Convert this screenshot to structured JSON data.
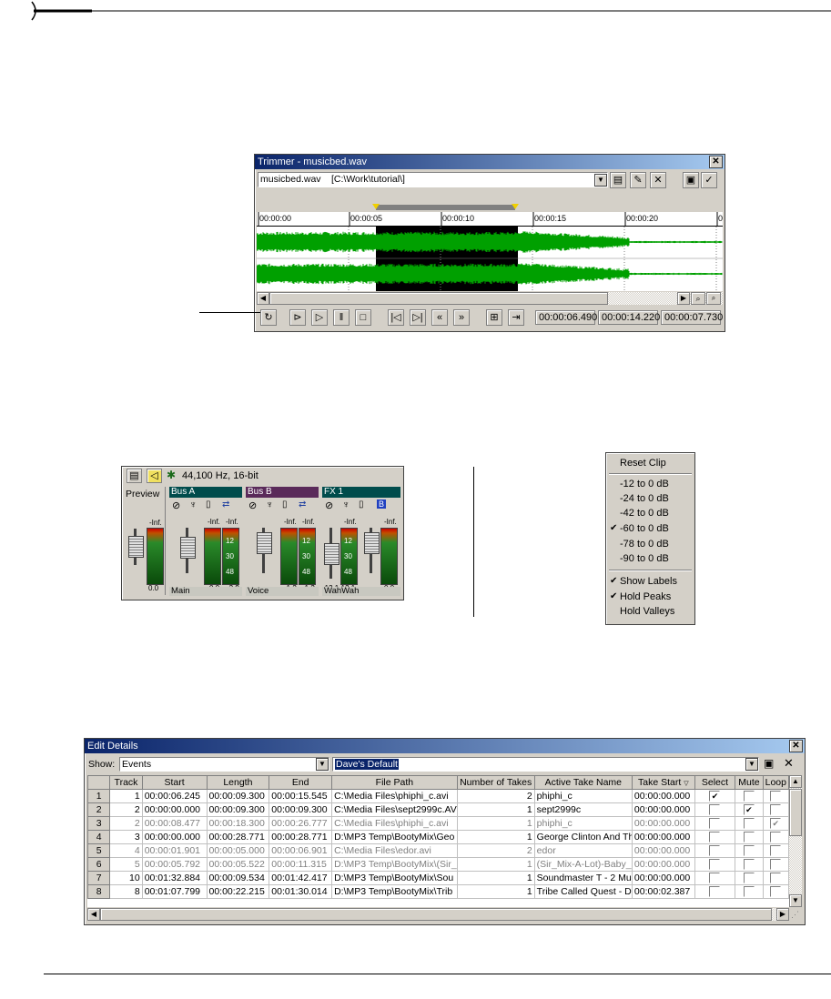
{
  "trimmer": {
    "title": "Trimmer - musicbed.wav",
    "file_name": "musicbed.wav",
    "file_path": "[C:\\Work\\tutorial\\]",
    "ruler_ticks": [
      "00:00:00",
      "00:00:05",
      "00:00:10",
      "00:00:15",
      "00:00:20",
      "00:0"
    ],
    "timecodes": [
      "00:00:06.490",
      "00:00:14.220",
      "00:00:07.730"
    ],
    "transport_icons": [
      "loop-icon",
      "play-from-start-icon",
      "play-icon",
      "pause-icon",
      "stop-icon",
      "go-to-start-icon",
      "go-to-end-icon",
      "rewind-icon",
      "fast-forward-icon",
      "insert-icon",
      "add-to-timeline-icon"
    ],
    "colors": {
      "waveform": "#00a000",
      "selection": "#000000"
    }
  },
  "mixer": {
    "format_label": "44,100 Hz, 16-bit",
    "preview_label": "Preview",
    "buses": [
      {
        "name": "Bus A",
        "footer": "Main",
        "header_color": "#004c4c"
      },
      {
        "name": "Bus B",
        "footer": "Voice",
        "header_color": "#5a2a5a"
      },
      {
        "name": "FX 1",
        "footer": "WahWah",
        "header_color": "#004c4c"
      }
    ],
    "inf_label": "-Inf.",
    "scale": [
      "12",
      "30",
      "48"
    ],
    "readouts": {
      "preview": "0.0",
      "bus_a": [
        "0.0",
        "-3.9"
      ],
      "bus_b": [
        "-1.2",
        "-1.2"
      ],
      "fx1": [
        "-12.1",
        "-12.1",
        "0.0"
      ]
    }
  },
  "context_menu": {
    "items": [
      {
        "label": "Reset Clip",
        "checked": false
      },
      {
        "label": "-12 to 0 dB",
        "checked": false
      },
      {
        "label": "-24 to 0 dB",
        "checked": false
      },
      {
        "label": "-42 to 0 dB",
        "checked": false
      },
      {
        "label": "-60 to 0 dB",
        "checked": true
      },
      {
        "label": "-78 to 0 dB",
        "checked": false
      },
      {
        "label": "-90 to 0 dB",
        "checked": false
      },
      {
        "label": "Show Labels",
        "checked": true
      },
      {
        "label": "Hold Peaks",
        "checked": true
      },
      {
        "label": "Hold Valleys",
        "checked": false
      }
    ],
    "check_glyph": "✔"
  },
  "edit_details": {
    "title": "Edit Details",
    "show_label": "Show:",
    "show_value": "Events",
    "preset_value": "Dave's Default",
    "columns": [
      "",
      "Track",
      "Start",
      "Length",
      "End",
      "File Path",
      "Number of Takes",
      "Active Take Name",
      "Take Start",
      "Select",
      "Mute",
      "Loop"
    ],
    "rows": [
      {
        "n": "1",
        "track": "1",
        "start": "00:00:06.245",
        "length": "00:00:09.300",
        "end": "00:00:15.545",
        "path": "C:\\Media Files\\phiphi_c.avi",
        "takes": "2",
        "take": "phiphi_c",
        "take_start": "00:00:00.000",
        "select": "✔",
        "mute": "",
        "loop": "",
        "dim": false
      },
      {
        "n": "2",
        "track": "2",
        "start": "00:00:00.000",
        "length": "00:00:09.300",
        "end": "00:00:09.300",
        "path": "C:\\Media Files\\sept2999c.AV",
        "takes": "1",
        "take": "sept2999c",
        "take_start": "00:00:00.000",
        "select": "",
        "mute": "✔",
        "loop": "",
        "dim": false
      },
      {
        "n": "3",
        "track": "2",
        "start": "00:00:08.477",
        "length": "00:00:18.300",
        "end": "00:00:26.777",
        "path": "C:\\Media Files\\phiphi_c.avi",
        "takes": "1",
        "take": "phiphi_c",
        "take_start": "00:00:00.000",
        "select": "",
        "mute": "",
        "loop": "✔",
        "dim": true
      },
      {
        "n": "4",
        "track": "3",
        "start": "00:00:00.000",
        "length": "00:00:28.771",
        "end": "00:00:28.771",
        "path": "D:\\MP3 Temp\\BootyMix\\Geo",
        "takes": "1",
        "take": "George Clinton And Th",
        "take_start": "00:00:00.000",
        "select": "",
        "mute": "",
        "loop": "",
        "dim": false
      },
      {
        "n": "5",
        "track": "4",
        "start": "00:00:01.901",
        "length": "00:00:05.000",
        "end": "00:00:06.901",
        "path": "C:\\Media Files\\edor.avi",
        "takes": "2",
        "take": "edor",
        "take_start": "00:00:00.000",
        "select": "",
        "mute": "",
        "loop": "",
        "dim": true
      },
      {
        "n": "6",
        "track": "5",
        "start": "00:00:05.792",
        "length": "00:00:05.522",
        "end": "00:00:11.315",
        "path": "D:\\MP3 Temp\\BootyMix\\(Sir_",
        "takes": "1",
        "take": "(Sir_Mix-A-Lot)-Baby_(",
        "take_start": "00:00:00.000",
        "select": "",
        "mute": "",
        "loop": "",
        "dim": true
      },
      {
        "n": "7",
        "track": "10",
        "start": "00:01:32.884",
        "length": "00:00:09.534",
        "end": "00:01:42.417",
        "path": "D:\\MP3 Temp\\BootyMix\\Sou",
        "takes": "1",
        "take": "Soundmaster T - 2 Mu",
        "take_start": "00:00:00.000",
        "select": "",
        "mute": "",
        "loop": "",
        "dim": false
      },
      {
        "n": "8",
        "track": "8",
        "start": "00:01:07.799",
        "length": "00:00:22.215",
        "end": "00:01:30.014",
        "path": "D:\\MP3 Temp\\BootyMix\\Trib",
        "takes": "1",
        "take": "Tribe Called Quest - D",
        "take_start": "00:00:02.387",
        "select": "",
        "mute": "",
        "loop": "",
        "dim": false
      }
    ]
  }
}
